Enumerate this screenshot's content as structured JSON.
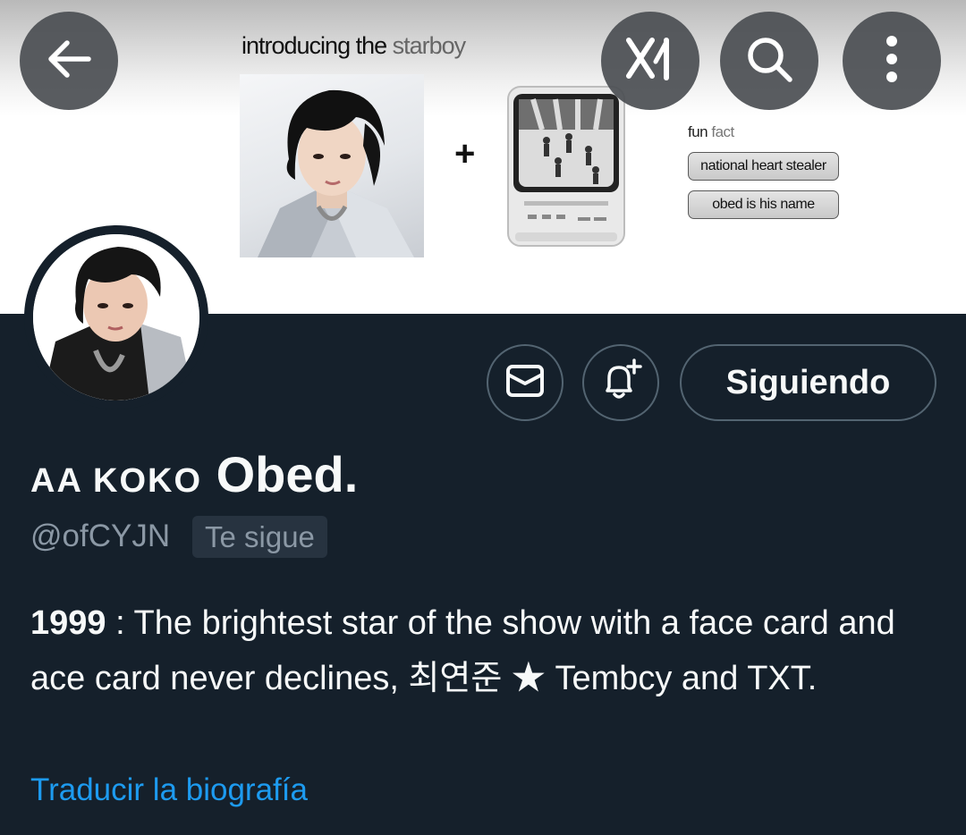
{
  "banner": {
    "title_prefix": "introducing the",
    "title_highlight": "starboy",
    "plus_sign": "+",
    "fun_prefix": "fun",
    "fun_highlight": "fact",
    "pill_1": "national heart stealer",
    "pill_2": "obed is his name"
  },
  "topbar": {
    "back_icon": "arrow-left-icon",
    "grok_icon": "grok-icon",
    "search_icon": "search-icon",
    "more_icon": "more-vertical-icon"
  },
  "actions": {
    "message_icon": "envelope-icon",
    "notify_icon": "bell-plus-icon",
    "follow_label": "Siguiendo"
  },
  "profile": {
    "display_name_smallcaps": "AA KOKO",
    "display_name_main": "Obed.",
    "handle": "@ofCYJN",
    "follows_you_badge": "Te sigue",
    "bio_bold": "1999",
    "bio_text": " : The brightest star of the show with a face card and ace card never declines, 최연준 ★ Tembcy and TXT.",
    "translate_link": "Traducir la biografía"
  },
  "colors": {
    "background": "#15202b",
    "accent_link": "#1d9bf0",
    "muted_text": "#8b98a5",
    "button_border": "#536471"
  }
}
